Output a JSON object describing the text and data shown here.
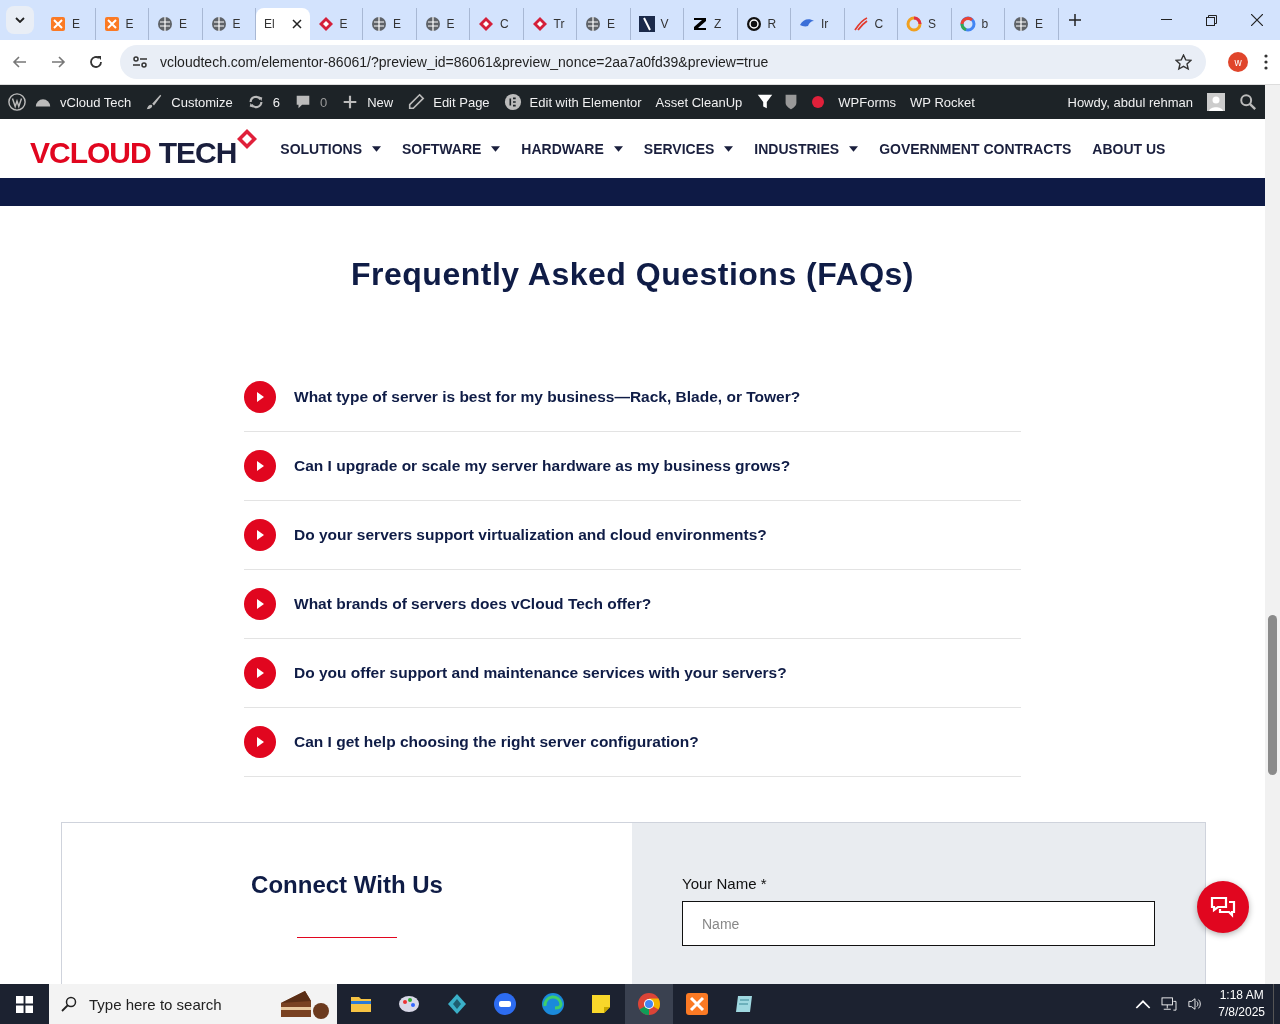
{
  "tabs": [
    {
      "label": "E",
      "kind": "xampp",
      "selected": false
    },
    {
      "label": "E",
      "kind": "xampp",
      "selected": false
    },
    {
      "label": "E",
      "kind": "globe",
      "selected": false
    },
    {
      "label": "E",
      "kind": "globe",
      "selected": false
    },
    {
      "label": "El",
      "kind": "plain",
      "selected": true
    },
    {
      "label": "E",
      "kind": "diamond",
      "selected": false
    },
    {
      "label": "E",
      "kind": "globe",
      "selected": false
    },
    {
      "label": "E",
      "kind": "globe",
      "selected": false
    },
    {
      "label": "C",
      "kind": "diamond",
      "selected": false
    },
    {
      "label": "Tr",
      "kind": "diamond",
      "selected": false
    },
    {
      "label": "E",
      "kind": "globe",
      "selected": false
    },
    {
      "label": "V",
      "kind": "slash",
      "selected": false
    },
    {
      "label": "Z",
      "kind": "zee",
      "selected": false
    },
    {
      "label": "R",
      "kind": "ring",
      "selected": false
    },
    {
      "label": "Ir",
      "kind": "bird",
      "selected": false
    },
    {
      "label": "C",
      "kind": "swoosh",
      "selected": false
    },
    {
      "label": "S",
      "kind": "circle",
      "selected": false
    },
    {
      "label": "b",
      "kind": "google",
      "selected": false
    },
    {
      "label": "E",
      "kind": "globe",
      "selected": false
    }
  ],
  "address": "vcloudtech.com/elementor-86061/?preview_id=86061&preview_nonce=2aa7a0fd39&preview=true",
  "profile_initial": "w",
  "admin_bar": {
    "items": [
      "vCloud Tech",
      "Customize",
      "6",
      "0",
      "New",
      "Edit Page",
      "Edit with Elementor",
      "Asset CleanUp",
      "WPForms",
      "WP Rocket"
    ],
    "greeting": "Howdy, abdul rehman"
  },
  "logo": {
    "word1": "VCLOUD",
    "word2": "TECH"
  },
  "nav": [
    {
      "label": "SOLUTIONS",
      "dropdown": true
    },
    {
      "label": "SOFTWARE",
      "dropdown": true
    },
    {
      "label": "HARDWARE",
      "dropdown": true
    },
    {
      "label": "SERVICES",
      "dropdown": true
    },
    {
      "label": "INDUSTRIES",
      "dropdown": true
    },
    {
      "label": "GOVERNMENT CONTRACTS",
      "dropdown": false
    },
    {
      "label": "ABOUT US",
      "dropdown": false
    }
  ],
  "faq": {
    "title": "Frequently Asked Questions (FAQs)",
    "items": [
      {
        "question": "What type of server is best for my business—Rack, Blade, or Tower?",
        "expanded": false
      },
      {
        "question": "Can I upgrade or scale my server hardware as my business grows?",
        "expanded": false
      },
      {
        "question": "Do your servers support virtualization and cloud environments?",
        "expanded": false
      },
      {
        "question": "What brands of servers does vCloud Tech offer?",
        "expanded": false
      },
      {
        "question": "Do you offer support and maintenance services with your servers?",
        "expanded": false
      },
      {
        "question": "Can I get help choosing the right server configuration?",
        "expanded": false
      }
    ]
  },
  "connect": {
    "title": "Connect With Us",
    "form": {
      "name_label": "Your Name *",
      "name_placeholder": "Name"
    }
  },
  "taskbar": {
    "search_placeholder": "Type here to search",
    "time": "1:18 AM",
    "date": "7/8/2025"
  }
}
